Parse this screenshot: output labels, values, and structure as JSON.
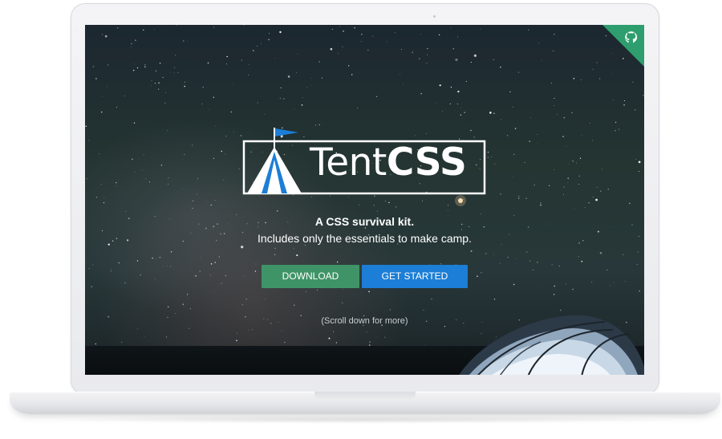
{
  "hero": {
    "logo_text_regular": "Tent",
    "logo_text_bold": "CSS",
    "tagline": "A CSS survival kit.",
    "subtagline": "Includes only the essentials to make camp.",
    "scroll_hint": "(Scroll down for more)"
  },
  "buttons": {
    "download_label": "DOWNLOAD",
    "get_started_label": "GET STARTED"
  },
  "ribbon": {
    "icon": "github-octocat-icon"
  },
  "colors": {
    "download_green": "#3f9467",
    "get_started_blue": "#1c7ed6",
    "ribbon_green": "#2e9e6e",
    "flag_blue": "#1c7ed6"
  }
}
